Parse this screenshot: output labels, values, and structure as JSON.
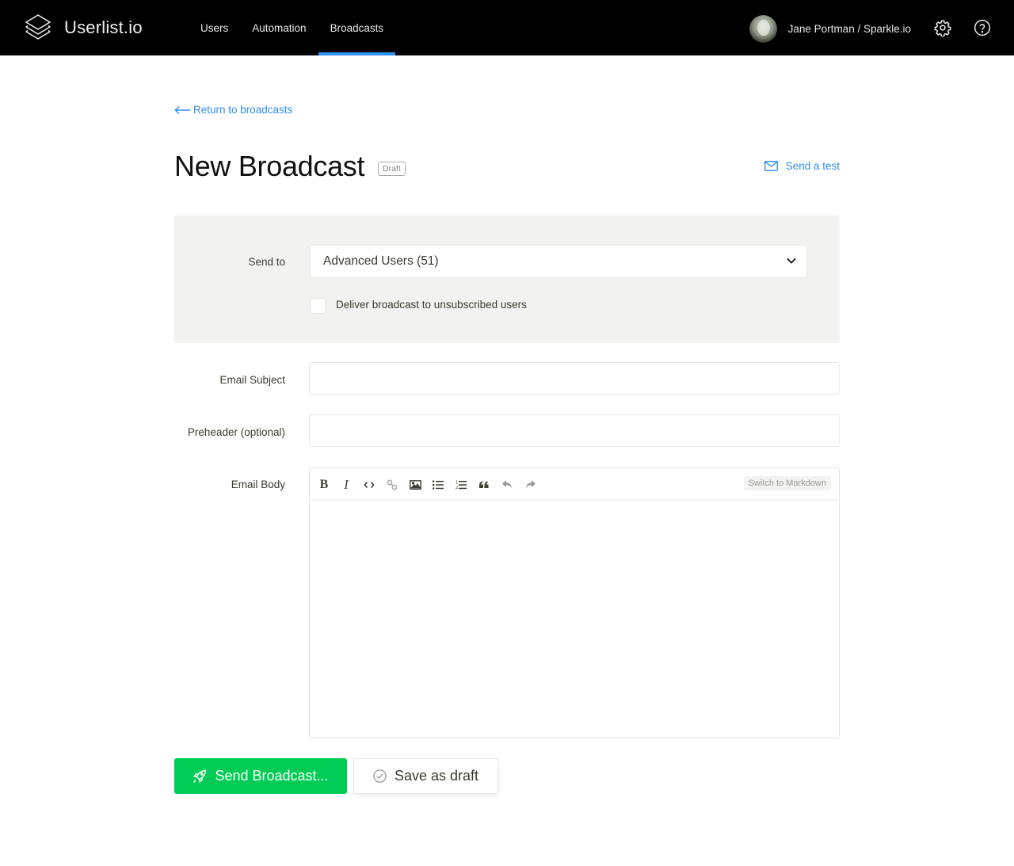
{
  "app": {
    "name": "Userlist.io",
    "logo_icon": "stacked-layers-icon"
  },
  "nav": {
    "items": [
      {
        "label": "Users",
        "active": false
      },
      {
        "label": "Automation",
        "active": false
      },
      {
        "label": "Broadcasts",
        "active": true
      }
    ]
  },
  "user": {
    "name": "Jane Portman / Sparkle.io",
    "settings_icon": "gear-icon",
    "help_icon": "question-circle-icon"
  },
  "page": {
    "back_link": "Return to broadcasts",
    "title": "New Broadcast",
    "status_badge": "Draft",
    "send_test": "Send a test"
  },
  "form": {
    "send_to": {
      "label": "Send to",
      "value": "Advanced Users (51)"
    },
    "unsubscribed": {
      "label": "Deliver broadcast to unsubscribed users",
      "checked": false
    },
    "subject": {
      "label": "Email Subject",
      "value": ""
    },
    "preheader": {
      "label": "Preheader (optional)",
      "value": ""
    },
    "body": {
      "label": "Email Body",
      "toolbar": [
        "bold",
        "italic",
        "code",
        "link",
        "image",
        "bulleted-list",
        "numbered-list",
        "quote",
        "undo",
        "redo"
      ],
      "switch_label": "Switch to Markdown",
      "value": ""
    }
  },
  "actions": {
    "send_label": "Send Broadcast...",
    "draft_label": "Save as draft"
  },
  "colors": {
    "accent": "#2f8ef0",
    "primary_button": "#00cc55",
    "topbar": "#000000",
    "panel": "#f2f2f0"
  }
}
